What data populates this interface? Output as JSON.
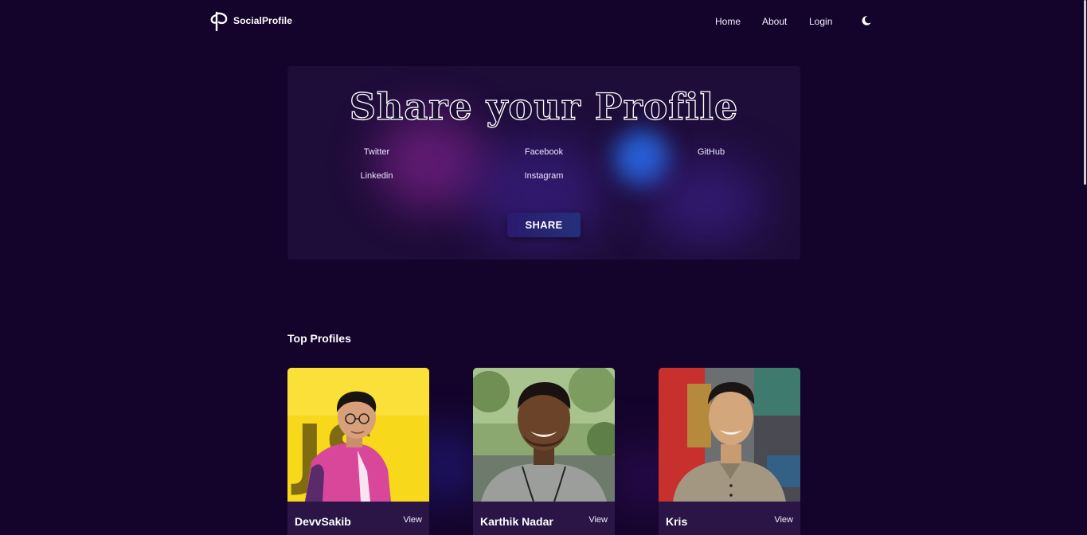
{
  "header": {
    "brand_name": "SocialProfile",
    "nav": {
      "home": "Home",
      "about": "About",
      "login": "Login"
    },
    "theme_icon": "moon-icon",
    "logo_icon": "brand-logo-icon"
  },
  "share": {
    "title": "Share your Profile",
    "platforms": {
      "twitter": "Twitter",
      "facebook": "Facebook",
      "github": "GitHub",
      "linkedin": "Linkedin",
      "instagram": "Instagram"
    },
    "button_label": "SHARE"
  },
  "top_profiles": {
    "title": "Top Profiles",
    "profiles": [
      {
        "name": "DevvSakib",
        "action": "View",
        "photo": "profile-photo"
      },
      {
        "name": "Karthik Nadar",
        "action": "View",
        "photo": "profile-photo"
      },
      {
        "name": "Kris",
        "action": "View",
        "photo": "profile-photo"
      }
    ]
  },
  "colors": {
    "background": "#14042b",
    "card": "#1e0c39",
    "card_footer": "#2a1546",
    "button": "#2a1a6e"
  }
}
